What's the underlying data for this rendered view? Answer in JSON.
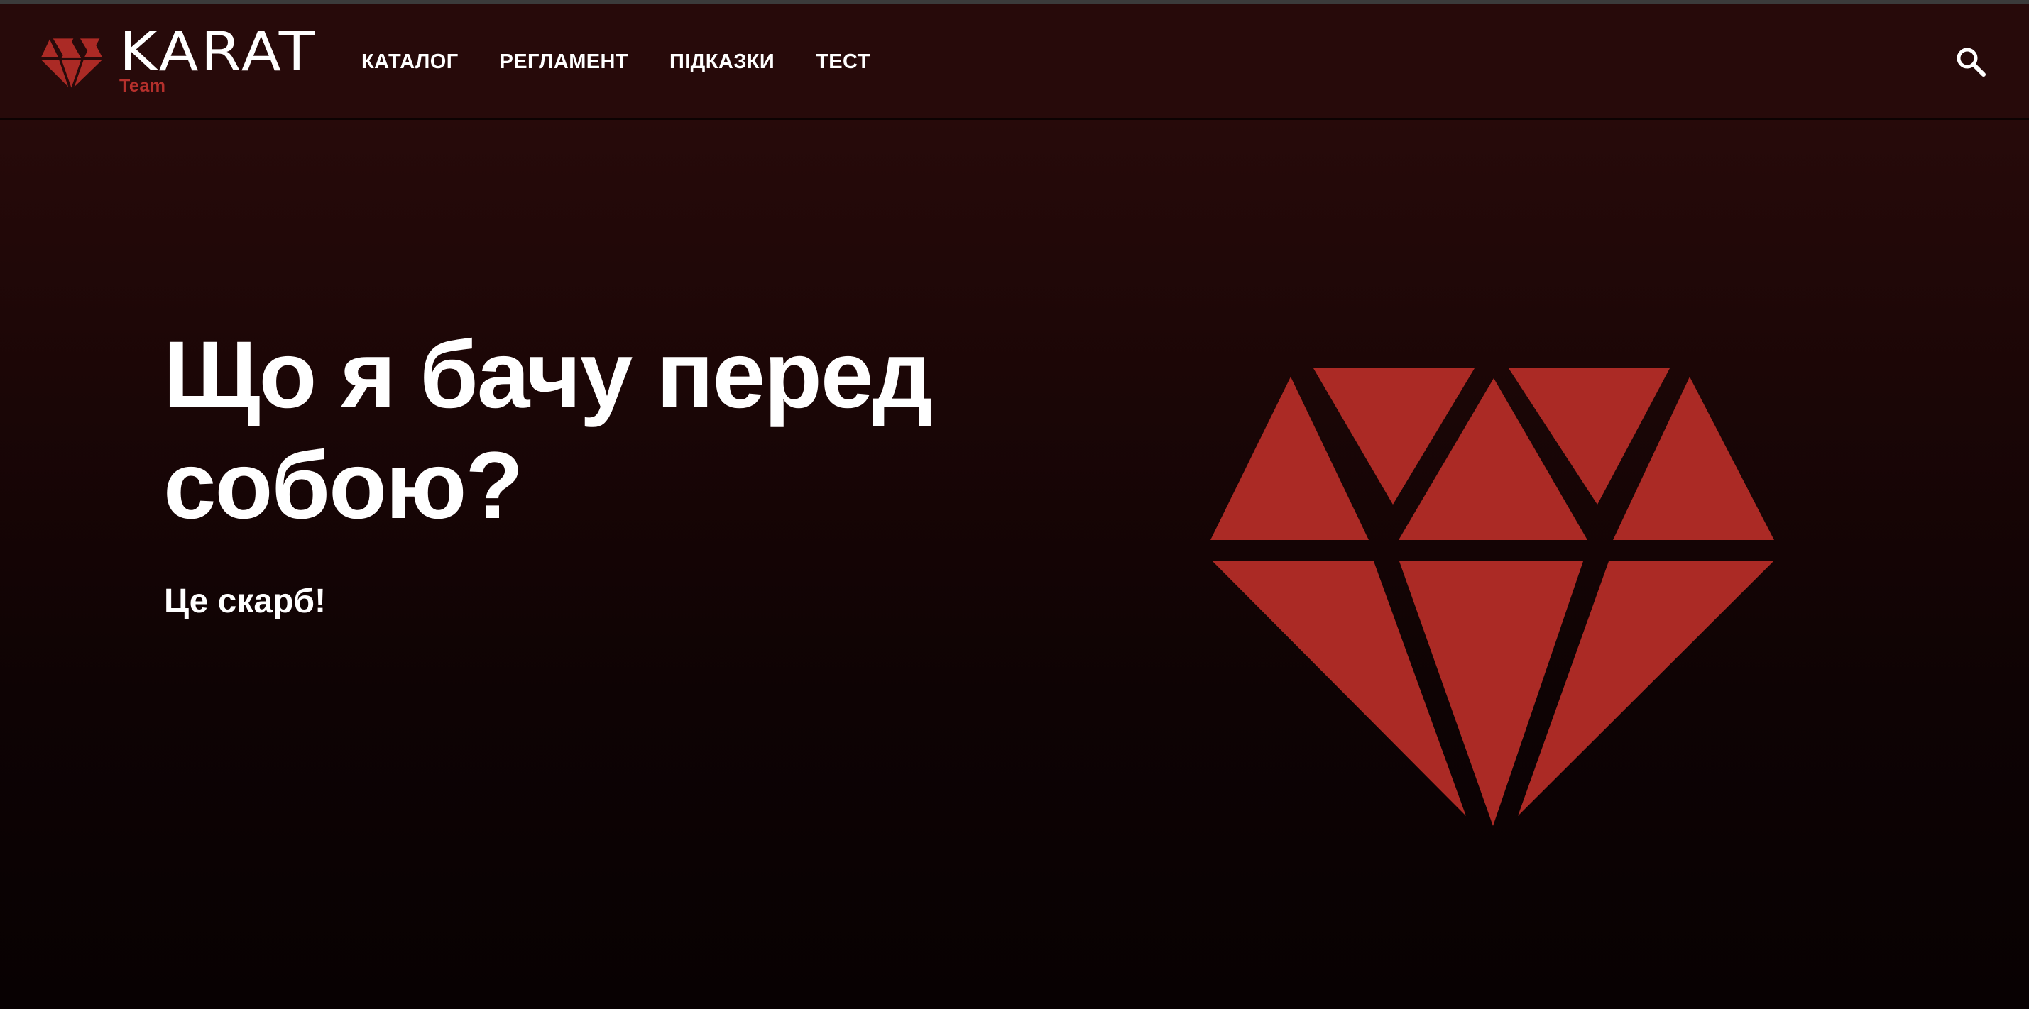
{
  "colors": {
    "background_top": "#270a0a",
    "background_bottom": "#080102",
    "accent_red": "#ab2a25",
    "text": "#ffffff"
  },
  "logo": {
    "wordmark": "KARAT",
    "subtitle": "Team",
    "icon": "diamond-icon"
  },
  "nav": {
    "items": [
      {
        "label": "КАТАЛОГ"
      },
      {
        "label": "РЕГЛАМЕНТ"
      },
      {
        "label": "ПІДКАЗКИ"
      },
      {
        "label": "ТЕСТ"
      }
    ]
  },
  "search": {
    "icon": "search-icon"
  },
  "hero": {
    "title": "Що я бачу перед собою?",
    "subtitle": "Це скарб!",
    "illustration": "diamond-illustration"
  }
}
